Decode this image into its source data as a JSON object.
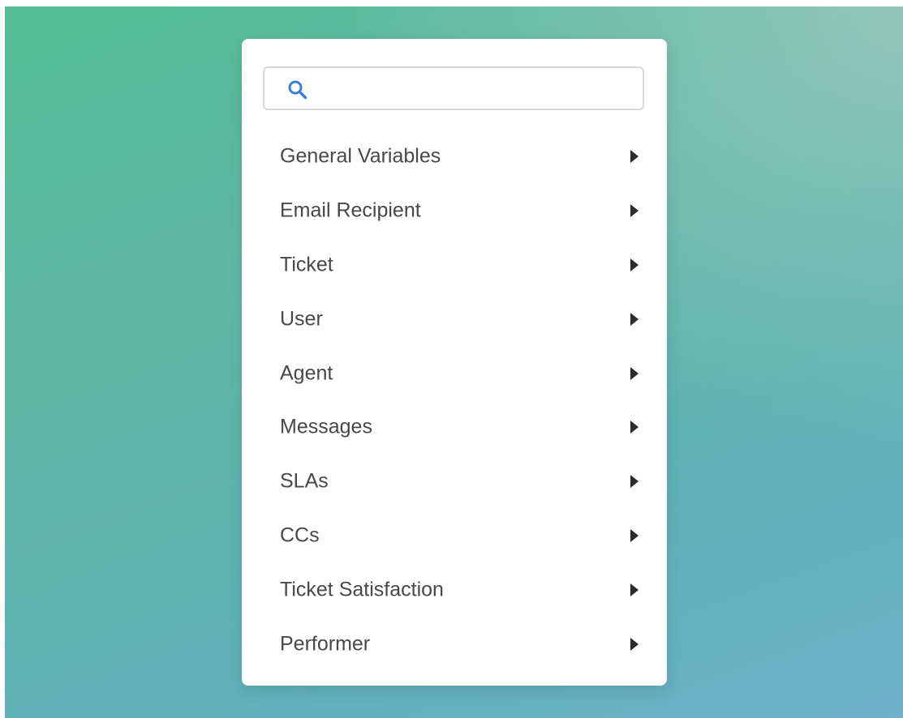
{
  "search": {
    "value": "",
    "placeholder": "",
    "icon": "search-icon",
    "icon_color": "#3d7fd6"
  },
  "menu": {
    "items": [
      {
        "label": "General Variables",
        "icon": "chevron-right-icon"
      },
      {
        "label": "Email Recipient",
        "icon": "chevron-right-icon"
      },
      {
        "label": "Ticket",
        "icon": "chevron-right-icon"
      },
      {
        "label": "User",
        "icon": "chevron-right-icon"
      },
      {
        "label": "Agent",
        "icon": "chevron-right-icon"
      },
      {
        "label": "Messages",
        "icon": "chevron-right-icon"
      },
      {
        "label": "SLAs",
        "icon": "chevron-right-icon"
      },
      {
        "label": "CCs",
        "icon": "chevron-right-icon"
      },
      {
        "label": "Ticket Satisfaction",
        "icon": "chevron-right-icon"
      },
      {
        "label": "Performer",
        "icon": "chevron-right-icon"
      }
    ]
  },
  "colors": {
    "panel_background": "#ffffff",
    "label_text": "#47484a",
    "backdrop_top": "#55bd96",
    "backdrop_bottom": "#6cb0c9"
  }
}
